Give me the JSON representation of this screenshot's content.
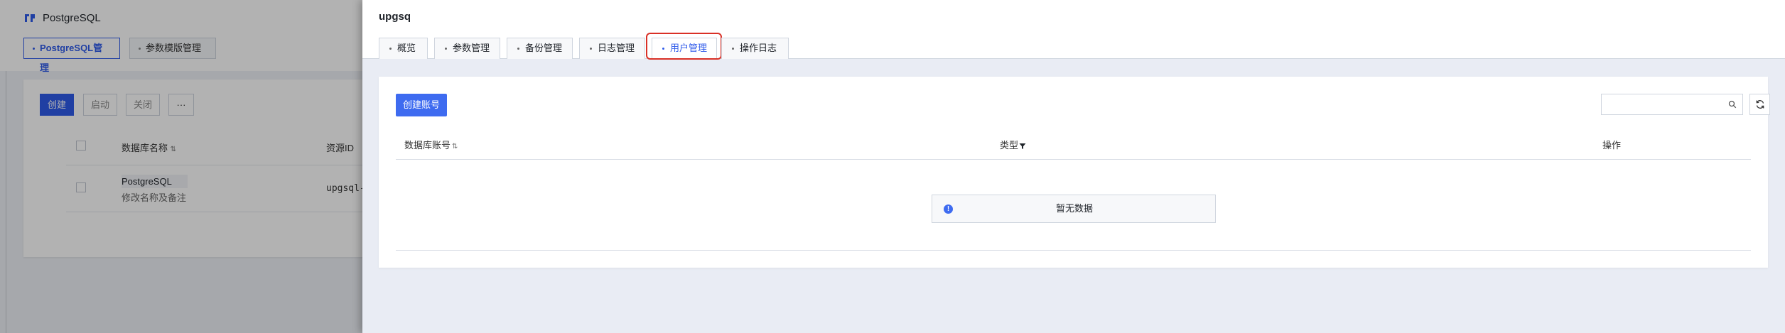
{
  "background": {
    "app_title": "PostgreSQL",
    "tabs": [
      {
        "label": "PostgreSQL管理"
      },
      {
        "label": "参数模版管理"
      }
    ],
    "toolbar": {
      "create_label": "创建",
      "start_label": "启动",
      "stop_label": "关闭",
      "more_label": "···"
    },
    "table": {
      "col_name": "数据库名称",
      "col_id": "资源ID",
      "rows": [
        {
          "name": "PostgreSQL",
          "note": "修改名称及备注",
          "id": "upgsql-"
        }
      ]
    }
  },
  "drawer": {
    "title": "upgsq",
    "tabs": [
      {
        "label": "概览"
      },
      {
        "label": "参数管理"
      },
      {
        "label": "备份管理"
      },
      {
        "label": "日志管理"
      },
      {
        "label": "用户管理"
      },
      {
        "label": "操作日志"
      }
    ],
    "active_tab": "用户管理",
    "create_account_label": "创建账号",
    "search": {
      "placeholder": "",
      "value": ""
    },
    "table": {
      "col_account": "数据库账号",
      "col_account_sort": "⇅",
      "col_type": "类型",
      "col_actions": "操作"
    },
    "empty_text": "暂无数据"
  },
  "colors": {
    "primary": "#3e6bf0",
    "highlight": "#d93026"
  },
  "icons": [
    "pg-logo-icon",
    "search-icon",
    "refresh-icon",
    "filter-icon",
    "info-icon",
    "sort-icon"
  ]
}
